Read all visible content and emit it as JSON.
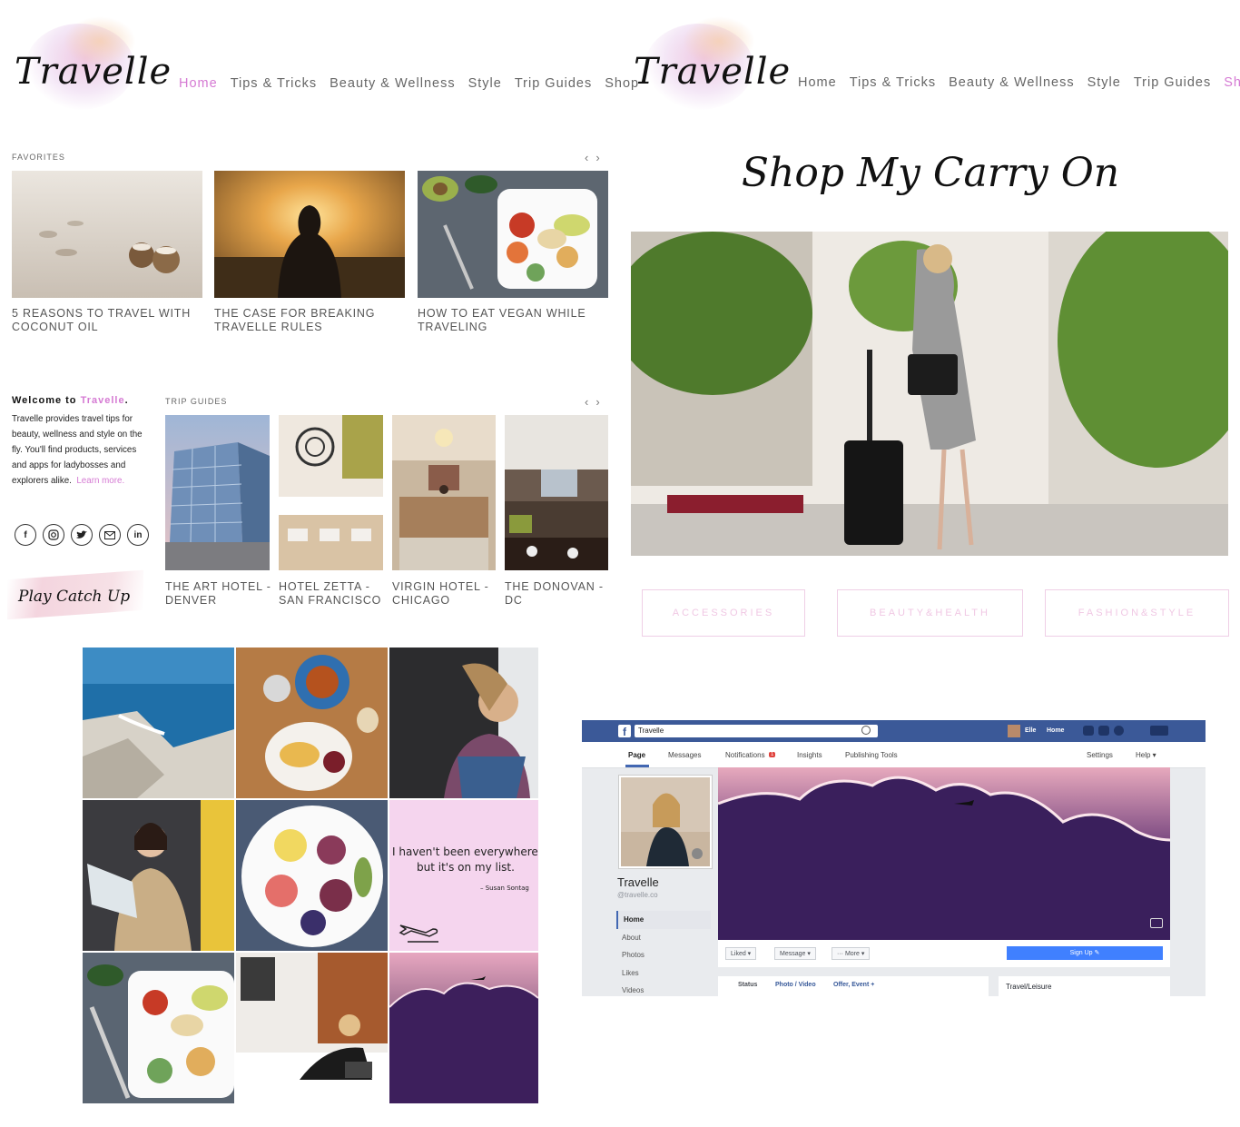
{
  "site": {
    "logo_text": "Travelle",
    "nav": [
      "Home",
      "Tips & Tricks",
      "Beauty & Wellness",
      "Style",
      "Trip Guides",
      "Shop"
    ],
    "accent": "#d57ad3"
  },
  "home": {
    "favorites_label": "FAVORITES",
    "favorites": [
      {
        "caption": "5 REASONS TO TRAVEL WITH COCONUT OIL"
      },
      {
        "caption": "THE CASE FOR BREAKING TRAVELLE RULES"
      },
      {
        "caption": "HOW TO EAT VEGAN WHILE TRAVELING"
      }
    ],
    "welcome": {
      "title_prefix": "Welcome to ",
      "title_brand": "Travelle",
      "title_suffix": ".",
      "text": "Travelle provides travel tips for beauty, wellness and style on the fly. You'll find products, services and apps for ladybosses and explorers alike.",
      "learn_more": "Learn more."
    },
    "social_icons": [
      "facebook-icon",
      "instagram-icon",
      "twitter-icon",
      "mail-icon",
      "linkedin-icon"
    ],
    "trip_guides_label": "TRIP GUIDES",
    "trip_guides": [
      {
        "caption": "THE ART HOTEL - DENVER"
      },
      {
        "caption": "HOTEL ZETTA - SAN FRANCISCO"
      },
      {
        "caption": "VIRGIN HOTEL - CHICAGO"
      },
      {
        "caption": "THE DONOVAN - DC"
      }
    ],
    "catch_up": "Play Catch Up"
  },
  "shop": {
    "title": "Shop My Carry On",
    "categories": [
      "ACCESSORIES",
      "BEAUTY&HEALTH",
      "FASHION&STYLE"
    ]
  },
  "instagram": {
    "quote_line1": "I haven't been everywhere",
    "quote_line2": "but it's on my list.",
    "quote_author": "– Susan Sontag"
  },
  "facebook": {
    "search_value": "Travelle",
    "user_name": "Elle",
    "home_link": "Home",
    "tabs": [
      "Page",
      "Messages",
      "Notifications",
      "Insights",
      "Publishing Tools"
    ],
    "notifications_badge": "1",
    "right_tabs": [
      "Settings",
      "Help ▾"
    ],
    "page_name": "Travelle",
    "page_handle": "@travelle.co",
    "menu": [
      "Home",
      "About",
      "Photos",
      "Likes",
      "Videos"
    ],
    "liked": "Liked ▾",
    "message": "Message ▾",
    "more": "··· More ▾",
    "signup": "Sign Up ✎",
    "status": "Status",
    "photo_video": "Photo / Video",
    "offer_event": "Offer, Event +",
    "category": "Travel/Leisure"
  }
}
